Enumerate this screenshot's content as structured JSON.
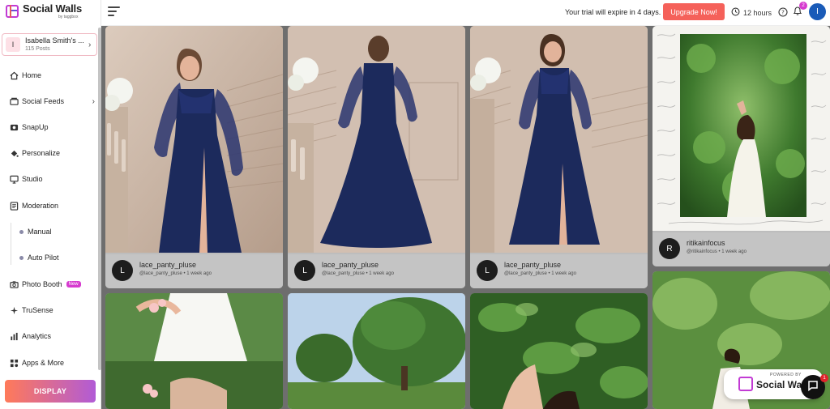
{
  "app": {
    "title": "Social Walls",
    "subtitle": "by taggbox"
  },
  "wall": {
    "avatar_letter": "I",
    "name": "Isabella Smith's ...",
    "posts": "115 Posts"
  },
  "nav": {
    "home": "Home",
    "social_feeds": "Social Feeds",
    "snapup": "SnapUp",
    "personalize": "Personalize",
    "studio": "Studio",
    "moderation": "Moderation",
    "manual": "Manual",
    "auto_pilot": "Auto Pilot",
    "photo_booth": "Photo Booth",
    "photo_booth_badge": "New",
    "trusense": "TruSense",
    "analytics": "Analytics",
    "apps_more": "Apps & More",
    "display": "DISPLAY"
  },
  "topbar": {
    "trial_text": "Your trial will expire in 4 days.",
    "upgrade_label": "Upgrade Now!",
    "time_label": "12 hours",
    "notification_count": "2",
    "user_initial": "I"
  },
  "posts": [
    {
      "avatar": "L",
      "user": "lace_panty_pluse",
      "handle": "@lace_panty_pluse",
      "time": "1 week ago"
    },
    {
      "avatar": "L",
      "user": "lace_panty_pluse",
      "handle": "@lace_panty_pluse",
      "time": "1 week ago"
    },
    {
      "avatar": "L",
      "user": "lace_panty_pluse",
      "handle": "@lace_panty_pluse",
      "time": "1 week ago"
    },
    {
      "avatar": "R",
      "user": "ritikainfocus",
      "handle": "@ritikainfocus",
      "time": "1 week ago"
    }
  ],
  "powered": {
    "small": "POWERED BY",
    "brand": "Social Walls"
  },
  "chat": {
    "badge": "1"
  },
  "colors": {
    "accent": "#f5615a",
    "brand_purple": "#c23bd4",
    "user_blue": "#1a5bb8",
    "dress_navy": "#1c2a5c"
  }
}
